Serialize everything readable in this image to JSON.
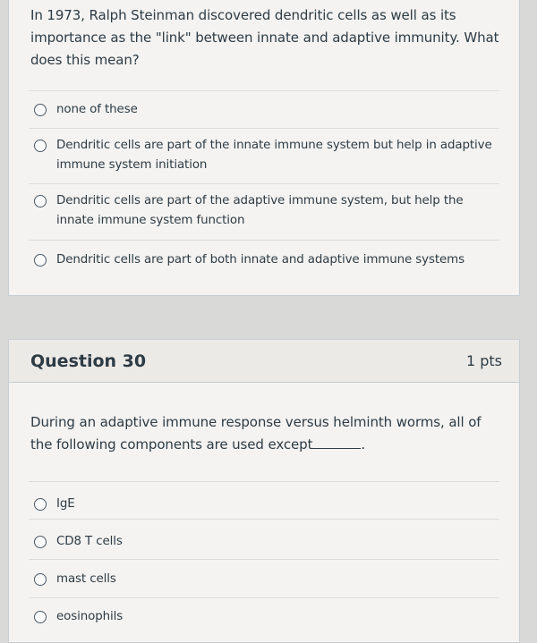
{
  "question29": {
    "prompt": "In 1973, Ralph Steinman discovered dendritic cells as well as its importance as the \"link\" between innate and adaptive immunity. What does this mean?",
    "answers": [
      "none of these",
      "Dendritic cells are part of the innate immune system but help in adaptive immune system initiation",
      "Dendritic cells are part of the adaptive immune system, but help the innate immune system function",
      "Dendritic cells are part of both innate and adaptive immune systems"
    ]
  },
  "question30": {
    "title": "Question 30",
    "points": "1 pts",
    "prompt_before": "During an adaptive immune response versus helminth worms, all of the following components are used except",
    "prompt_after": ".",
    "answers": [
      "IgE",
      "CD8 T cells",
      "mast cells",
      "eosinophils"
    ]
  }
}
